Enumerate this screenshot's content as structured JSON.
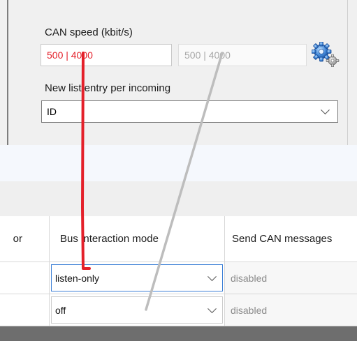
{
  "settings": {
    "can_speed_label": "CAN speed (kbit/s)",
    "can_speed_value": "500 | 4000",
    "can_speed_value_color": "#e4202a",
    "can_speed_secondary_value": "500 | 4000",
    "new_entry_label": "New list entry per incoming",
    "new_entry_value": "ID"
  },
  "table": {
    "columns": [
      "or",
      "Bus interaction mode",
      "Send CAN messages"
    ],
    "rows": [
      {
        "mode": "listen-only",
        "send": "disabled"
      },
      {
        "mode": "off",
        "send": "disabled"
      }
    ]
  },
  "icons": {
    "settings_gear": "gear-icon",
    "dropdown": "chevron-down-icon"
  },
  "colors": {
    "annotation_red": "#e4202a",
    "annotation_gray": "#bdbdbd",
    "focus_blue": "#3c7fd6"
  }
}
